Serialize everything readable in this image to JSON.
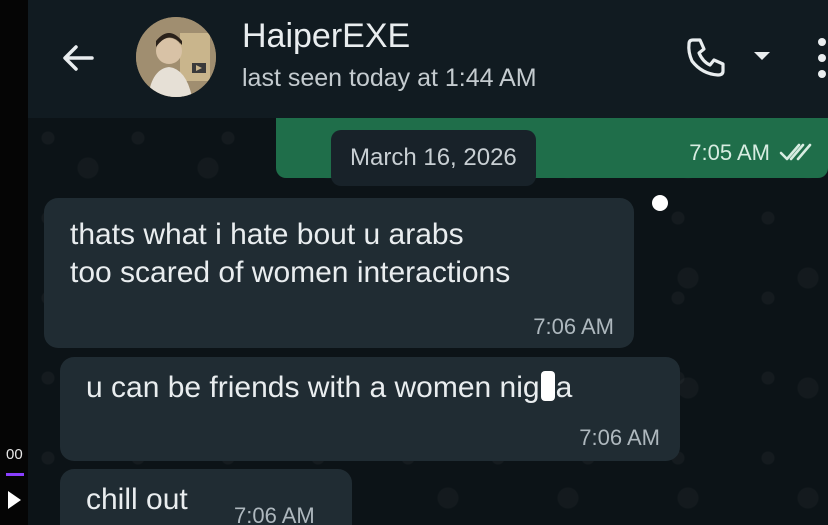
{
  "player": {
    "time": "00"
  },
  "header": {
    "contact_name": "HaiperEXE",
    "last_seen": "last seen today at 1:44 AM"
  },
  "messages": {
    "sent": {
      "time": "7:05 AM",
      "status": "read"
    },
    "date_divider": "March 16, 2026",
    "received": [
      {
        "line1": "thats what i hate bout u arabs",
        "line2": "too scared of women interactions",
        "time": "7:06 AM"
      },
      {
        "text_before": "u can be friends with a women nig",
        "text_after": "a",
        "time": "7:06 AM"
      },
      {
        "text": "chill out",
        "time": "7:06 AM"
      }
    ]
  },
  "colors": {
    "header_bg": "#111b21",
    "chat_bg": "#0c1317",
    "sent_bubble": "#1f6e4a",
    "received_bubble": "#202c33",
    "date_chip": "#182229",
    "player_progress": "#8a3fff"
  },
  "icons": {
    "back": "arrow-left-icon",
    "call": "phone-icon",
    "dropdown": "chevron-down-icon",
    "menu": "more-vert-icon",
    "read_status": "double-check-icon",
    "play": "play-icon"
  }
}
